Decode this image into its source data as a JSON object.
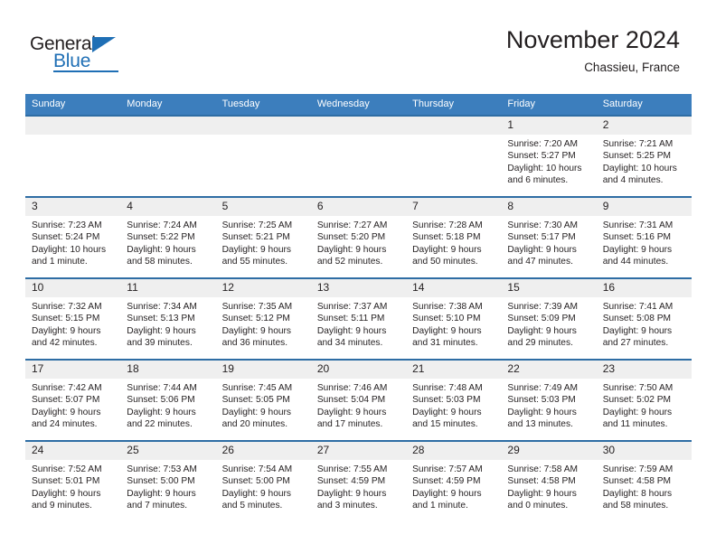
{
  "brand": {
    "name_part1": "General",
    "name_part2": "Blue",
    "triangle_color": "#1f6fb5"
  },
  "header": {
    "title": "November 2024",
    "subtitle": "Chassieu, France",
    "accent_color": "#3c7ebd"
  },
  "weekdays": [
    "Sunday",
    "Monday",
    "Tuesday",
    "Wednesday",
    "Thursday",
    "Friday",
    "Saturday"
  ],
  "labels": {
    "sunrise_prefix": "Sunrise:",
    "sunset_prefix": "Sunset:",
    "daylight_prefix": "Daylight:"
  },
  "weeks": [
    [
      {
        "day": "",
        "line1": "",
        "line2": "",
        "line3": "",
        "line4": ""
      },
      {
        "day": "",
        "line1": "",
        "line2": "",
        "line3": "",
        "line4": ""
      },
      {
        "day": "",
        "line1": "",
        "line2": "",
        "line3": "",
        "line4": ""
      },
      {
        "day": "",
        "line1": "",
        "line2": "",
        "line3": "",
        "line4": ""
      },
      {
        "day": "",
        "line1": "",
        "line2": "",
        "line3": "",
        "line4": ""
      },
      {
        "day": "1",
        "line1": "Sunrise: 7:20 AM",
        "line2": "Sunset: 5:27 PM",
        "line3": "Daylight: 10 hours",
        "line4": "and 6 minutes."
      },
      {
        "day": "2",
        "line1": "Sunrise: 7:21 AM",
        "line2": "Sunset: 5:25 PM",
        "line3": "Daylight: 10 hours",
        "line4": "and 4 minutes."
      }
    ],
    [
      {
        "day": "3",
        "line1": "Sunrise: 7:23 AM",
        "line2": "Sunset: 5:24 PM",
        "line3": "Daylight: 10 hours",
        "line4": "and 1 minute."
      },
      {
        "day": "4",
        "line1": "Sunrise: 7:24 AM",
        "line2": "Sunset: 5:22 PM",
        "line3": "Daylight: 9 hours",
        "line4": "and 58 minutes."
      },
      {
        "day": "5",
        "line1": "Sunrise: 7:25 AM",
        "line2": "Sunset: 5:21 PM",
        "line3": "Daylight: 9 hours",
        "line4": "and 55 minutes."
      },
      {
        "day": "6",
        "line1": "Sunrise: 7:27 AM",
        "line2": "Sunset: 5:20 PM",
        "line3": "Daylight: 9 hours",
        "line4": "and 52 minutes."
      },
      {
        "day": "7",
        "line1": "Sunrise: 7:28 AM",
        "line2": "Sunset: 5:18 PM",
        "line3": "Daylight: 9 hours",
        "line4": "and 50 minutes."
      },
      {
        "day": "8",
        "line1": "Sunrise: 7:30 AM",
        "line2": "Sunset: 5:17 PM",
        "line3": "Daylight: 9 hours",
        "line4": "and 47 minutes."
      },
      {
        "day": "9",
        "line1": "Sunrise: 7:31 AM",
        "line2": "Sunset: 5:16 PM",
        "line3": "Daylight: 9 hours",
        "line4": "and 44 minutes."
      }
    ],
    [
      {
        "day": "10",
        "line1": "Sunrise: 7:32 AM",
        "line2": "Sunset: 5:15 PM",
        "line3": "Daylight: 9 hours",
        "line4": "and 42 minutes."
      },
      {
        "day": "11",
        "line1": "Sunrise: 7:34 AM",
        "line2": "Sunset: 5:13 PM",
        "line3": "Daylight: 9 hours",
        "line4": "and 39 minutes."
      },
      {
        "day": "12",
        "line1": "Sunrise: 7:35 AM",
        "line2": "Sunset: 5:12 PM",
        "line3": "Daylight: 9 hours",
        "line4": "and 36 minutes."
      },
      {
        "day": "13",
        "line1": "Sunrise: 7:37 AM",
        "line2": "Sunset: 5:11 PM",
        "line3": "Daylight: 9 hours",
        "line4": "and 34 minutes."
      },
      {
        "day": "14",
        "line1": "Sunrise: 7:38 AM",
        "line2": "Sunset: 5:10 PM",
        "line3": "Daylight: 9 hours",
        "line4": "and 31 minutes."
      },
      {
        "day": "15",
        "line1": "Sunrise: 7:39 AM",
        "line2": "Sunset: 5:09 PM",
        "line3": "Daylight: 9 hours",
        "line4": "and 29 minutes."
      },
      {
        "day": "16",
        "line1": "Sunrise: 7:41 AM",
        "line2": "Sunset: 5:08 PM",
        "line3": "Daylight: 9 hours",
        "line4": "and 27 minutes."
      }
    ],
    [
      {
        "day": "17",
        "line1": "Sunrise: 7:42 AM",
        "line2": "Sunset: 5:07 PM",
        "line3": "Daylight: 9 hours",
        "line4": "and 24 minutes."
      },
      {
        "day": "18",
        "line1": "Sunrise: 7:44 AM",
        "line2": "Sunset: 5:06 PM",
        "line3": "Daylight: 9 hours",
        "line4": "and 22 minutes."
      },
      {
        "day": "19",
        "line1": "Sunrise: 7:45 AM",
        "line2": "Sunset: 5:05 PM",
        "line3": "Daylight: 9 hours",
        "line4": "and 20 minutes."
      },
      {
        "day": "20",
        "line1": "Sunrise: 7:46 AM",
        "line2": "Sunset: 5:04 PM",
        "line3": "Daylight: 9 hours",
        "line4": "and 17 minutes."
      },
      {
        "day": "21",
        "line1": "Sunrise: 7:48 AM",
        "line2": "Sunset: 5:03 PM",
        "line3": "Daylight: 9 hours",
        "line4": "and 15 minutes."
      },
      {
        "day": "22",
        "line1": "Sunrise: 7:49 AM",
        "line2": "Sunset: 5:03 PM",
        "line3": "Daylight: 9 hours",
        "line4": "and 13 minutes."
      },
      {
        "day": "23",
        "line1": "Sunrise: 7:50 AM",
        "line2": "Sunset: 5:02 PM",
        "line3": "Daylight: 9 hours",
        "line4": "and 11 minutes."
      }
    ],
    [
      {
        "day": "24",
        "line1": "Sunrise: 7:52 AM",
        "line2": "Sunset: 5:01 PM",
        "line3": "Daylight: 9 hours",
        "line4": "and 9 minutes."
      },
      {
        "day": "25",
        "line1": "Sunrise: 7:53 AM",
        "line2": "Sunset: 5:00 PM",
        "line3": "Daylight: 9 hours",
        "line4": "and 7 minutes."
      },
      {
        "day": "26",
        "line1": "Sunrise: 7:54 AM",
        "line2": "Sunset: 5:00 PM",
        "line3": "Daylight: 9 hours",
        "line4": "and 5 minutes."
      },
      {
        "day": "27",
        "line1": "Sunrise: 7:55 AM",
        "line2": "Sunset: 4:59 PM",
        "line3": "Daylight: 9 hours",
        "line4": "and 3 minutes."
      },
      {
        "day": "28",
        "line1": "Sunrise: 7:57 AM",
        "line2": "Sunset: 4:59 PM",
        "line3": "Daylight: 9 hours",
        "line4": "and 1 minute."
      },
      {
        "day": "29",
        "line1": "Sunrise: 7:58 AM",
        "line2": "Sunset: 4:58 PM",
        "line3": "Daylight: 9 hours",
        "line4": "and 0 minutes."
      },
      {
        "day": "30",
        "line1": "Sunrise: 7:59 AM",
        "line2": "Sunset: 4:58 PM",
        "line3": "Daylight: 8 hours",
        "line4": "and 58 minutes."
      }
    ]
  ]
}
